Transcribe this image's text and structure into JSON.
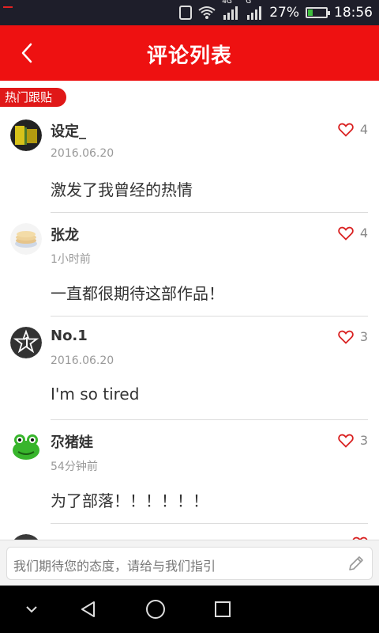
{
  "status_bar": {
    "network_label": "4G",
    "signal2_label": "G",
    "battery_percent": "27%",
    "battery_level": 0.27,
    "time": "18:56"
  },
  "header": {
    "title": "评论列表",
    "back_icon": "chevron-left-icon",
    "background_color": "#ee1111"
  },
  "section_tag": "热门跟贴",
  "comments": [
    {
      "user": "设定_",
      "time": "2016.06.20",
      "text": "激发了我曾经的热情",
      "likes": "4"
    },
    {
      "user": "张龙",
      "time": "1小时前",
      "text": "一直都很期待这部作品！",
      "likes": "4"
    },
    {
      "user": "No.1",
      "time": "2016.06.20",
      "text": "I'm so tired",
      "likes": "3"
    },
    {
      "user": "尕猪娃",
      "time": "54分钟前",
      "text": "为了部落！！！！！！",
      "likes": "3"
    }
  ],
  "comment_bar": {
    "placeholder": "我们期待您的态度，请给与我们指引",
    "icon": "pencil-icon"
  },
  "nav_bar": {
    "icons": [
      "chevron-down-icon",
      "back-triangle-icon",
      "home-circle-icon",
      "recents-square-icon"
    ]
  }
}
